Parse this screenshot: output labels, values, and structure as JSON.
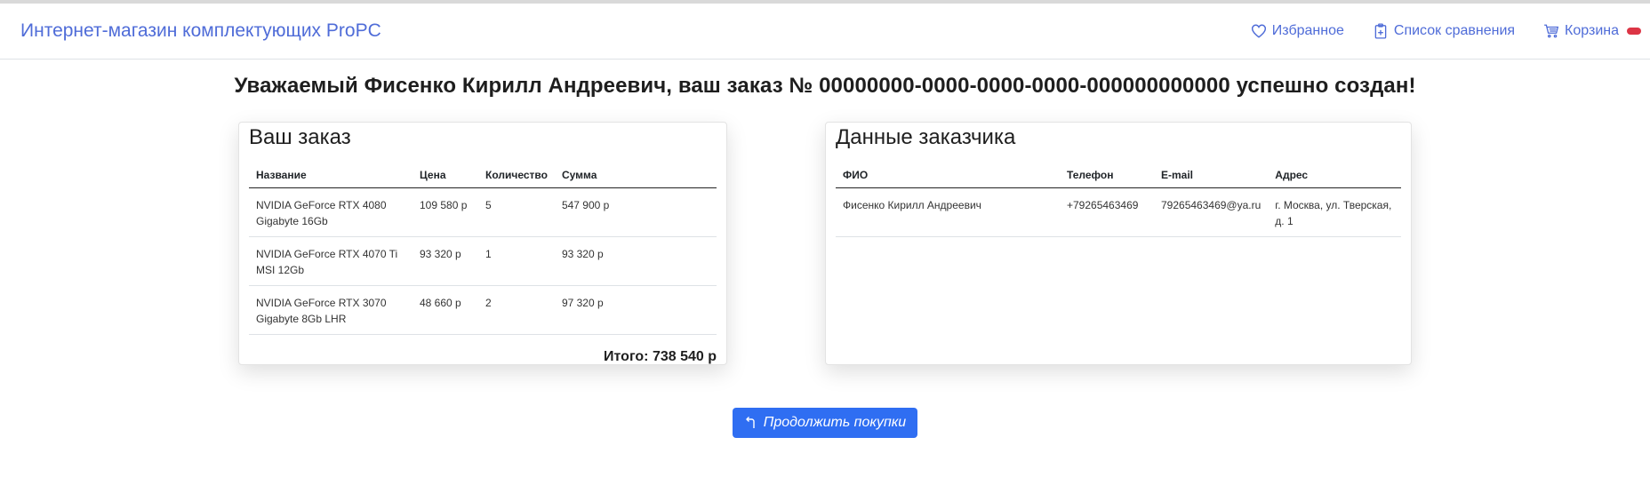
{
  "nav": {
    "brand": "Интернет-магазин комплектующих ProPC",
    "favorites": "Избранное",
    "compare": "Список сравнения",
    "cart": "Корзина"
  },
  "title": "Уважаемый Фисенко Кирилл Андреевич, ваш заказ № 00000000-0000-0000-0000-000000000000 успешно создан!",
  "order": {
    "heading": "Ваш заказ",
    "columns": [
      "Название",
      "Цена",
      "Количество",
      "Сумма"
    ],
    "rows": [
      {
        "name": "NVIDIA GeForce RTX 4080 Gigabyte 16Gb",
        "price": "109 580 р",
        "qty": "5",
        "sum": "547 900 р"
      },
      {
        "name": "NVIDIA GeForce RTX 4070 Ti MSI 12Gb",
        "price": "93 320 р",
        "qty": "1",
        "sum": "93 320 р"
      },
      {
        "name": "NVIDIA GeForce RTX 3070 Gigabyte 8Gb LHR",
        "price": "48 660 р",
        "qty": "2",
        "sum": "97 320 р"
      }
    ],
    "total": "Итого: 738 540 р"
  },
  "customer": {
    "heading": "Данные заказчика",
    "columns": [
      "ФИО",
      "Телефон",
      "E-mail",
      "Адрес"
    ],
    "row": {
      "name": "Фисенко Кирилл Андреевич",
      "phone": "+79265463469",
      "email": "79265463469@ya.ru",
      "address": "г. Москва, ул. Тверская, д. 1"
    }
  },
  "continue_button": "Продолжить покупки",
  "colors": {
    "link": "#4f6cd8",
    "button": "#2f6ef2",
    "badge": "#dc3545"
  }
}
